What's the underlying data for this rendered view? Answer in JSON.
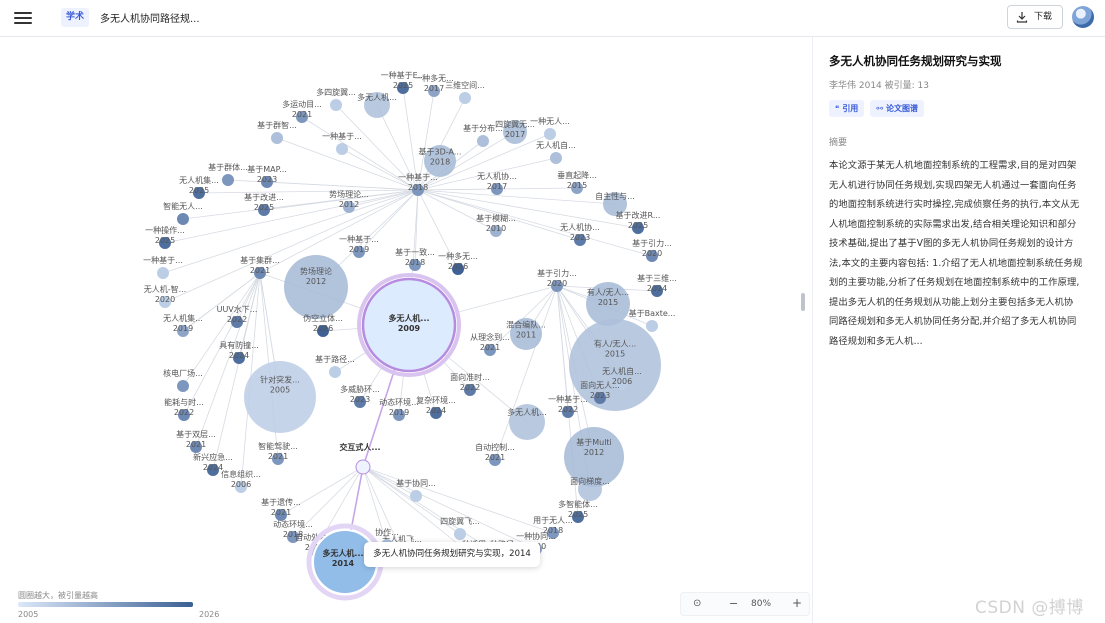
{
  "header": {
    "logo_text": "学术",
    "doc_title": "多无人机协同路径规...",
    "download_label": "下载"
  },
  "side": {
    "title": "多无人机协同任务规划研究与实现",
    "meta": "李华伟 2014 被引量: 13",
    "cite_label": "引用",
    "graph_label": "论文图谱",
    "abstract_label": "摘要",
    "abstract_lines": [
      "本论文源于某无人机地面控制系统的工程需求,目的是对四架",
      "无人机进行协同任务规划,实现四架无人机通过一套面向任务",
      "的地面控制系统进行实时操控,完成侦察任务的执行,本文从无",
      "人机地面控制系统的实际需求出发,结合相关理论知识和部分",
      "技术基础,提出了基于V图的多无人机协同任务规划的设计方",
      "法,本文的主要内容包括: 1.介绍了无人机地面控制系统任务规",
      "划的主要功能,分析了任务规划在地面控制系统中的工作原理,",
      "提出多无人机的任务规划从功能上划分主要包括多无人机协",
      "同路径规划和多无人机协同任务分配,并介绍了多无人机协同",
      "路径规划和多无人机..."
    ]
  },
  "legend": {
    "caption": "圆圈越大，被引量越高",
    "year_start": "2005",
    "year_end": "2026"
  },
  "zoom": {
    "fit_icon": "target-icon",
    "minus": "−",
    "value": "80%",
    "plus": "+"
  },
  "tooltip": "多无人机协同任务规划研究与实现，2014",
  "watermark": "CSDN @搏博",
  "colors": {
    "node_light": "#dce8fa",
    "node_dark": "#4a6fa0",
    "highlight": "#b68be0",
    "accent": "#3a5bd9"
  },
  "graph": {
    "center": {
      "id": "c1",
      "title": "多无人机...",
      "year": "2009"
    },
    "hub": {
      "id": "c2",
      "title": "交互式人..."
    },
    "selected": {
      "id": "c3",
      "title": "多无人机...",
      "year": "2014"
    },
    "nodes": [
      {
        "id": "n1",
        "t": "一种基于E...",
        "y": "2025",
        "lvl": 0.9
      },
      {
        "id": "n2",
        "t": "一种多无...",
        "y": "2017",
        "lvl": 0.5
      },
      {
        "id": "n3",
        "t": "三维空间...",
        "y": "",
        "lvl": 0.2
      },
      {
        "id": "n4",
        "t": "多四旋翼...",
        "y": "",
        "lvl": 0.2
      },
      {
        "id": "n5",
        "t": "多无人机...",
        "y": "",
        "lvl": 0.3
      },
      {
        "id": "n6",
        "t": "多运动目...",
        "y": "2021",
        "lvl": 0.6
      },
      {
        "id": "n7",
        "t": "基于群智...",
        "y": "",
        "lvl": 0.3
      },
      {
        "id": "n8",
        "t": "一种基于...",
        "y": "",
        "lvl": 0.2
      },
      {
        "id": "n9",
        "t": "基于3D-A...",
        "y": "2018",
        "lvl": 0.6
      },
      {
        "id": "n10",
        "t": "基于分布...",
        "y": "",
        "lvl": 0.3
      },
      {
        "id": "n11",
        "t": "四旋翼无...",
        "y": "2017",
        "lvl": 0.6
      },
      {
        "id": "n12",
        "t": "一种无人...",
        "y": "",
        "lvl": 0.2
      },
      {
        "id": "n13",
        "t": "无人机自...",
        "y": "",
        "lvl": 0.3
      },
      {
        "id": "n14",
        "t": "基于群体...",
        "y": "",
        "lvl": 0.6
      },
      {
        "id": "n15",
        "t": "无人机集...",
        "y": "2025",
        "lvl": 0.9
      },
      {
        "id": "n16",
        "t": "基于MAP...",
        "y": "2023",
        "lvl": 0.7
      },
      {
        "id": "n17",
        "t": "一种基于...",
        "y": "2018",
        "lvl": 0.6
      },
      {
        "id": "n18",
        "t": "无人机协...",
        "y": "2017",
        "lvl": 0.6
      },
      {
        "id": "n19",
        "t": "垂直起降...",
        "y": "2015",
        "lvl": 0.5
      },
      {
        "id": "n20",
        "t": "智能无人...",
        "y": "",
        "lvl": 0.7
      },
      {
        "id": "n21",
        "t": "势场理论...",
        "y": "2012",
        "lvl": 0.4
      },
      {
        "id": "n22",
        "t": "基于改进...",
        "y": "2025",
        "lvl": 0.8
      },
      {
        "id": "n23",
        "t": "自主性与...",
        "y": "",
        "lvl": 0.4
      },
      {
        "id": "n24",
        "t": "一种操作...",
        "y": "2025",
        "lvl": 0.9
      },
      {
        "id": "n25",
        "t": "基于模糊...",
        "y": "2010",
        "lvl": 0.4
      },
      {
        "id": "n26",
        "t": "基于改进R...",
        "y": "2025",
        "lvl": 0.9
      },
      {
        "id": "n27",
        "t": "一种基于...",
        "y": "",
        "lvl": 0.2
      },
      {
        "id": "n28",
        "t": "一种基于...",
        "y": "2019",
        "lvl": 0.6
      },
      {
        "id": "n29",
        "t": "无人机协...",
        "y": "2023",
        "lvl": 0.8
      },
      {
        "id": "n30",
        "t": "基于集群...",
        "y": "2021",
        "lvl": 0.7
      },
      {
        "id": "n31",
        "t": "基于一致...",
        "y": "2018",
        "lvl": 0.6
      },
      {
        "id": "n32",
        "t": "一种多无...",
        "y": "2026",
        "lvl": 1.0
      },
      {
        "id": "n33",
        "t": "基于引力...",
        "y": "2020",
        "lvl": 0.7
      },
      {
        "id": "n34",
        "t": "无人机-智...",
        "y": "2020",
        "lvl": 0.2
      },
      {
        "id": "n35",
        "t": "势场理论",
        "y": "2012",
        "lvl": 0.4
      },
      {
        "id": "n36",
        "t": "基于引力...",
        "y": "2020",
        "lvl": 0.6
      },
      {
        "id": "n37",
        "t": "基于三维...",
        "y": "2024",
        "lvl": 0.9
      },
      {
        "id": "n38",
        "t": "无人机集...",
        "y": "2019",
        "lvl": 0.5
      },
      {
        "id": "n39",
        "t": "UUV水下...",
        "y": "2022",
        "lvl": 0.8
      },
      {
        "id": "n40",
        "t": "有人/无人...",
        "y": "2015",
        "lvl": 0.5
      },
      {
        "id": "n41",
        "t": "基于Baxte...",
        "y": "",
        "lvl": 0.2
      },
      {
        "id": "n42",
        "t": "伪空立体...",
        "y": "2026",
        "lvl": 1.0
      },
      {
        "id": "n43",
        "t": "混合编队...",
        "y": "2011",
        "lvl": 0.4
      },
      {
        "id": "n44",
        "t": "具有防撞...",
        "y": "2024",
        "lvl": 0.9
      },
      {
        "id": "n45",
        "t": "从理念到...",
        "y": "2021",
        "lvl": 0.6
      },
      {
        "id": "n46",
        "t": "有人/无人...",
        "y": "2015",
        "lvl": 0.3
      },
      {
        "id": "n47",
        "t": "基于路径...",
        "y": "",
        "lvl": 0.2
      },
      {
        "id": "n48",
        "t": "无人机自...",
        "y": "2006",
        "lvl": 0.2
      },
      {
        "id": "n49",
        "t": "核电厂场...",
        "y": "",
        "lvl": 0.6
      },
      {
        "id": "n50",
        "t": "针对突发...",
        "y": "2005",
        "lvl": 0.2
      },
      {
        "id": "n51",
        "t": "面向准时...",
        "y": "2022",
        "lvl": 0.8
      },
      {
        "id": "n52",
        "t": "面向无人...",
        "y": "2023",
        "lvl": 0.8
      },
      {
        "id": "n53",
        "t": "多威胁环...",
        "y": "2023",
        "lvl": 0.8
      },
      {
        "id": "n54",
        "t": "一种基于...",
        "y": "2022",
        "lvl": 0.8
      },
      {
        "id": "n55",
        "t": "能耗与时...",
        "y": "2022",
        "lvl": 0.7
      },
      {
        "id": "n56",
        "t": "动态环境...",
        "y": "2019",
        "lvl": 0.6
      },
      {
        "id": "n57",
        "t": "复杂环境...",
        "y": "2024",
        "lvl": 0.9
      },
      {
        "id": "n58",
        "t": "多无人机...",
        "y": "",
        "lvl": 0.3
      },
      {
        "id": "n59",
        "t": "基于双层...",
        "y": "2021",
        "lvl": 0.7
      },
      {
        "id": "n60",
        "t": "智能驾驶...",
        "y": "2021",
        "lvl": 0.6
      },
      {
        "id": "n61",
        "t": "基于Multi",
        "y": "2012",
        "lvl": 0.5
      },
      {
        "id": "n62",
        "t": "自动控制...",
        "y": "2021",
        "lvl": 0.6
      },
      {
        "id": "n63",
        "t": "新兴应急...",
        "y": "2024",
        "lvl": 0.9
      },
      {
        "id": "n64",
        "t": "面向梯度...",
        "y": "",
        "lvl": 0.3
      },
      {
        "id": "n65",
        "t": "信息组织...",
        "y": "2006",
        "lvl": 0.2
      },
      {
        "id": "n66",
        "t": "基于协同...",
        "y": "",
        "lvl": 0.2
      },
      {
        "id": "n67",
        "t": "基于遗传...",
        "y": "2021",
        "lvl": 0.7
      },
      {
        "id": "n68",
        "t": "多智能体...",
        "y": "2025",
        "lvl": 0.9
      },
      {
        "id": "n69",
        "t": "动态环境...",
        "y": "2018",
        "lvl": 0.6
      },
      {
        "id": "n70",
        "t": "用于无人...",
        "y": "2018",
        "lvl": 0.6
      },
      {
        "id": "n71",
        "t": "四旋翼飞...",
        "y": "",
        "lvl": 0.2
      },
      {
        "id": "n72",
        "t": "自动外骨...",
        "y": "2017",
        "lvl": 0.5
      },
      {
        "id": "n73",
        "t": "无人机飞...",
        "y": "2014",
        "lvl": 0.4
      },
      {
        "id": "n74",
        "t": "一种适用...",
        "y": "2014",
        "lvl": 0.4
      },
      {
        "id": "n75",
        "t": "一种路径...",
        "y": "2018",
        "lvl": 0.5
      },
      {
        "id": "n76",
        "t": "一种协同...",
        "y": "2020",
        "lvl": 0.5
      },
      {
        "id": "n77",
        "t": "协作...",
        "y": "",
        "lvl": 0.3
      }
    ]
  }
}
